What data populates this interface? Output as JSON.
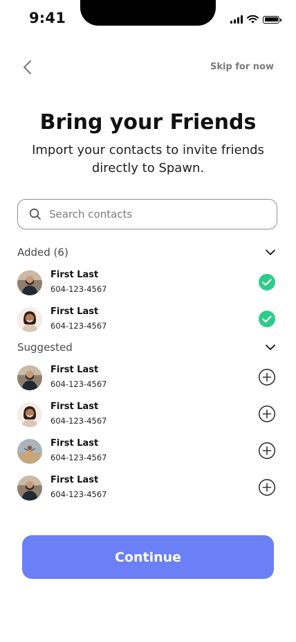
{
  "status_bar": {
    "time": "9:41"
  },
  "nav": {
    "skip_label": "Skip for now"
  },
  "header": {
    "title": "Bring your Friends",
    "subtitle": "Import your contacts to invite friends directly to Spawn."
  },
  "search": {
    "placeholder": "Search contacts"
  },
  "added": {
    "label": "Added (6)",
    "contacts": [
      {
        "name": "First Last",
        "phone": "604-123-4567",
        "avatar": "man-bearded"
      },
      {
        "name": "First Last",
        "phone": "604-123-4567",
        "avatar": "woman-smiling"
      }
    ]
  },
  "suggested": {
    "label": "Suggested",
    "contacts": [
      {
        "name": "First Last",
        "phone": "604-123-4567",
        "avatar": "man-bearded"
      },
      {
        "name": "First Last",
        "phone": "604-123-4567",
        "avatar": "woman-smiling"
      },
      {
        "name": "First Last",
        "phone": "604-123-4567",
        "avatar": "person-outdoors"
      },
      {
        "name": "First Last",
        "phone": "604-123-4567",
        "avatar": "man-bearded"
      }
    ]
  },
  "footer": {
    "continue_label": "Continue"
  },
  "colors": {
    "accent": "#6b7ff7",
    "check": "#2ecc8a"
  }
}
